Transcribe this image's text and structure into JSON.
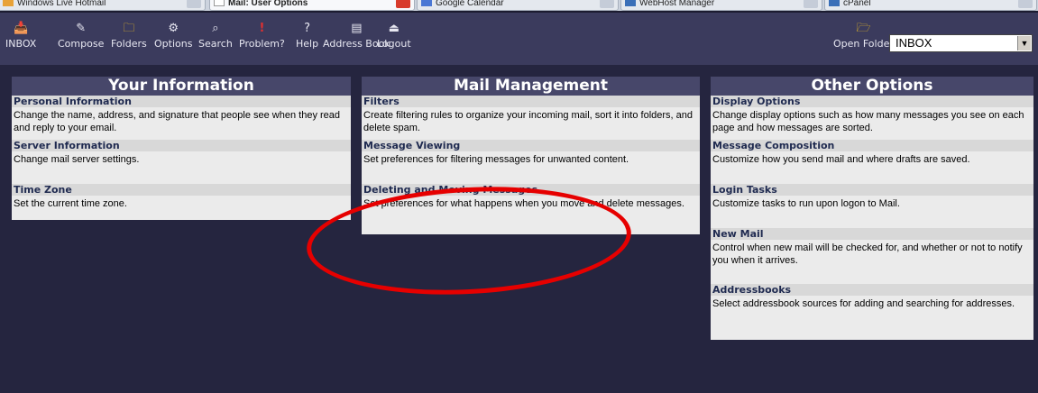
{
  "browser_tabs": [
    {
      "label": "Windows Live Hotmail",
      "active": false
    },
    {
      "label": "Mail: User Options",
      "active": true
    },
    {
      "label": "Google Calendar",
      "active": false
    },
    {
      "label": "WebHost Manager",
      "active": false
    },
    {
      "label": "cPanel",
      "active": false
    }
  ],
  "toolbar": {
    "buttons": [
      {
        "label": "INBOX",
        "icon": "inbox-icon",
        "glyph": "📥"
      },
      {
        "label": "Compose",
        "icon": "compose-icon",
        "glyph": "✎"
      },
      {
        "label": "Folders",
        "icon": "folders-icon",
        "glyph": "🗀"
      },
      {
        "label": "Options",
        "icon": "options-icon",
        "glyph": "⚙"
      },
      {
        "label": "Search",
        "icon": "search-icon",
        "glyph": "⌕"
      },
      {
        "label": "Problem?",
        "icon": "problem-icon",
        "glyph": "!"
      },
      {
        "label": "Help",
        "icon": "help-icon",
        "glyph": "?"
      },
      {
        "label": "Address Book",
        "icon": "address-book-icon",
        "glyph": "▤"
      },
      {
        "label": "Logout",
        "icon": "logout-icon",
        "glyph": "⏏"
      }
    ],
    "open_folder_label": "Open Folder",
    "folder_selected": "INBOX"
  },
  "columns": [
    {
      "title": "Your Information",
      "sections": [
        {
          "title": "Personal Information",
          "desc": "Change the name, address, and signature that people see when they read and reply to your email."
        },
        {
          "title": "Server Information",
          "desc": "Change mail server settings."
        },
        {
          "title": "Time Zone",
          "desc": "Set the current time zone."
        }
      ]
    },
    {
      "title": "Mail Management",
      "sections": [
        {
          "title": "Filters",
          "desc": "Create filtering rules to organize your incoming mail, sort it into folders, and delete spam."
        },
        {
          "title": "Message Viewing",
          "desc": "Set preferences for filtering messages for unwanted content."
        },
        {
          "title": "Deleting and Moving Messages",
          "desc": "Set preferences for what happens when you move and delete messages."
        }
      ]
    },
    {
      "title": "Other Options",
      "sections": [
        {
          "title": "Display Options",
          "desc": "Change display options such as how many messages you see on each page and how messages are sorted."
        },
        {
          "title": "Message Composition",
          "desc": "Customize how you send mail and where drafts are saved."
        },
        {
          "title": "Login Tasks",
          "desc": "Customize tasks to run upon logon to Mail."
        },
        {
          "title": "New Mail",
          "desc": "Control when new mail will be checked for, and whether or not to notify you when it arrives."
        },
        {
          "title": "Addressbooks",
          "desc": "Select addressbook sources for adding and searching for addresses."
        }
      ]
    }
  ],
  "colors": {
    "page_bg": "#25253f",
    "toolbar_bg": "#3b3b5d",
    "column_header_bg": "#47476a",
    "section_title_bg": "#d8d8d8",
    "section_desc_bg": "#ebebeb",
    "annotation_circle": "#e60000"
  }
}
